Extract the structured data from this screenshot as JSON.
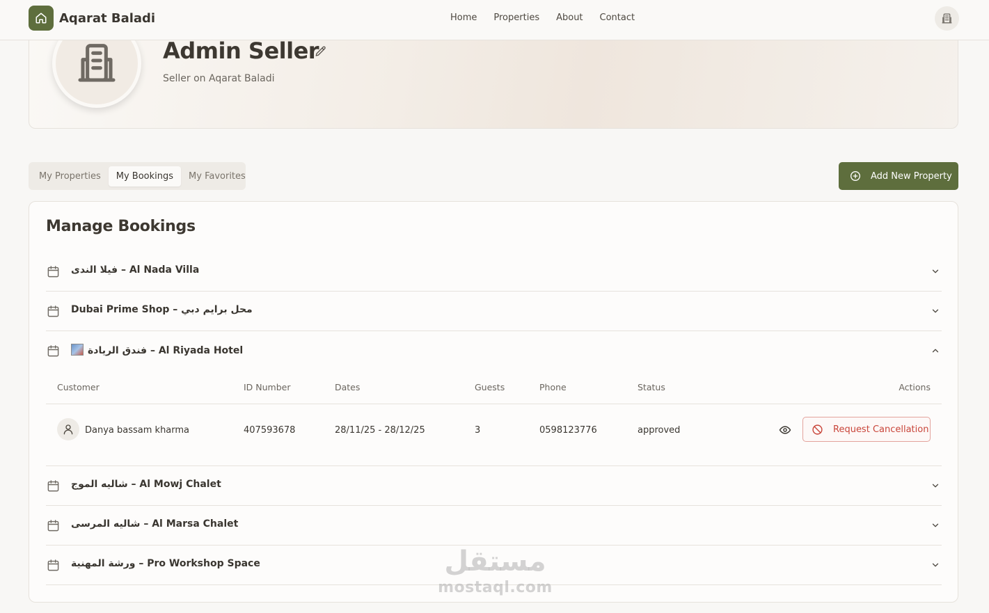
{
  "header": {
    "brand_name": "Aqarat Baladi",
    "nav": [
      "Home",
      "Properties",
      "About",
      "Contact"
    ]
  },
  "profile": {
    "name": "Admin Seller",
    "subtitle": "Seller on Aqarat Baladi"
  },
  "tabs": [
    {
      "label": "My Properties",
      "active": false
    },
    {
      "label": "My Bookings",
      "active": true
    },
    {
      "label": "My Favorites",
      "active": false
    }
  ],
  "add_button_label": "Add New Property",
  "bookings": {
    "title": "Manage Bookings",
    "properties": [
      {
        "label": "فيلا الندى – Al Nada Villa",
        "expanded": false
      },
      {
        "label": "Dubai Prime Shop – محل برايم دبي",
        "expanded": false
      },
      {
        "label": "فندق الريادة – Al Riyada Hotel",
        "expanded": true
      },
      {
        "label": "شاليه الموج – Al Mowj Chalet",
        "expanded": false
      },
      {
        "label": "شاليه المرسى – Al Marsa Chalet",
        "expanded": false
      },
      {
        "label": "ورشة المهنية – Pro Workshop Space",
        "expanded": false
      }
    ],
    "table": {
      "columns": [
        "Customer",
        "ID Number",
        "Dates",
        "Guests",
        "Phone",
        "Status",
        "Actions"
      ],
      "rows": [
        {
          "customer": "Danya bassam kharma",
          "id_number": "407593678",
          "dates": "28/11/25 - 28/12/25",
          "guests": "3",
          "phone": "0598123776",
          "status": "approved",
          "action_label": "Request Cancellation"
        }
      ]
    }
  },
  "watermark": {
    "arabic": "مستقل",
    "latin": "mostaql.com"
  },
  "colors": {
    "primary": "#5e6e3d",
    "danger": "#c9453a",
    "background": "#f8f7f5"
  }
}
